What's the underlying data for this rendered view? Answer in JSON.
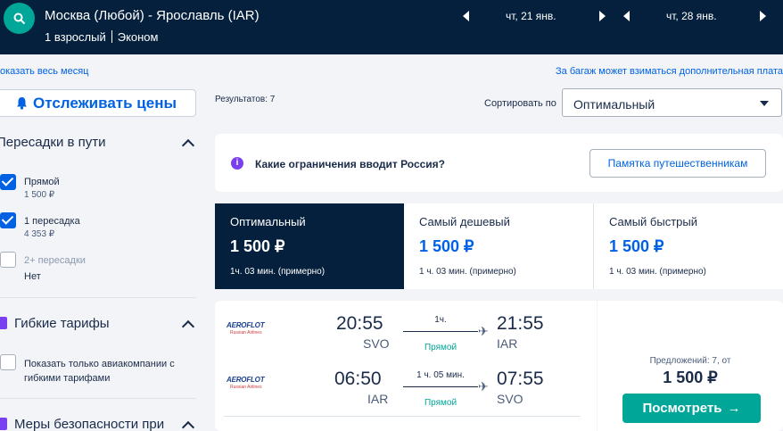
{
  "header": {
    "route": "Москва (Любой) - Ярославль (IAR)",
    "passengers": "1 взрослый",
    "cabin": "Эконом",
    "depart_date": "чт, 21 янв.",
    "return_date": "чт, 28 янв."
  },
  "links": {
    "month": "оказать весь месяц",
    "baggage": "За багаж может взиматься дополнительная плата"
  },
  "sidebar": {
    "track_button": "Отслеживать цены",
    "stops_title": "Пересадки в пути",
    "stops": [
      {
        "label": "Прямой",
        "price": "1 500 ₽",
        "checked": true
      },
      {
        "label": "1 пересадка",
        "price": "4 353 ₽",
        "checked": true
      },
      {
        "label": "2+ пересадки",
        "price": "Нет",
        "checked": false
      }
    ],
    "flex_title": "Гибкие тарифы",
    "flex_option_line1": "Показать только авиакомпании с",
    "flex_option_line2": "гибкими тарифами",
    "safety_title": "Меры безопасности при"
  },
  "main": {
    "results": "Результатов: 7",
    "sort_label": "Сортировать по",
    "sort_value": "Оптимальный",
    "info_text": "Какие ограничения вводит Россия?",
    "info_button": "Памятка путешественникам",
    "sort_tabs": [
      {
        "title": "Оптимальный",
        "price": "1 500 ₽",
        "duration": "1ч. 03 мин. (примерно)"
      },
      {
        "title": "Самый дешевый",
        "price": "1 500 ₽",
        "duration": "1 ч. 03 мин. (примерно)"
      },
      {
        "title": "Самый быстрый",
        "price": "1 500 ₽",
        "duration": "1 ч. 03 мин. (примерно)"
      }
    ],
    "flight": {
      "airline": "AEROFLOT",
      "airline_sub": "Russian Airlines",
      "outbound": {
        "dep_time": "20:55",
        "dep_code": "SVO",
        "duration": "1ч.",
        "stops": "Прямой",
        "arr_time": "21:55",
        "arr_code": "IAR"
      },
      "inbound": {
        "dep_time": "06:50",
        "dep_code": "IAR",
        "duration": "1 ч. 05 мин.",
        "stops": "Прямой",
        "arr_time": "07:55",
        "arr_code": "SVO"
      }
    },
    "offer": {
      "offers_text": "Предложений: 7, от",
      "price": "1 500 ₽",
      "button": "Посмотреть"
    }
  }
}
